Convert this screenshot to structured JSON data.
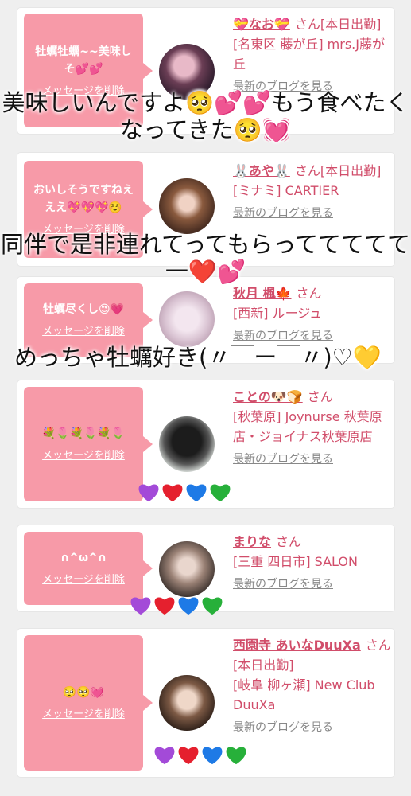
{
  "cards": [
    {
      "message": "牡蠣牡蠣~~美味しそ💕💕",
      "delete_label": "メッセージを削除",
      "name": "💝なお💝",
      "honorific": "さん[本日出勤]",
      "shop": "[名東区 藤が丘] mrs.J藤が丘",
      "blog_link": "最新のブログを見る"
    },
    {
      "message": "おいしそうですねえええ💖💖💖☺️",
      "delete_label": "メッセージを削除",
      "name": "🐰あや🐰",
      "honorific": "さん[本日出勤]",
      "shop": "[ミナミ] CARTIER",
      "blog_link": "最新のブログを見る"
    },
    {
      "message": "牡蠣尽くし😍💗",
      "delete_label": "メッセージを削除",
      "name": "秋月 楓🍁",
      "honorific": "さん",
      "shop": "[西新] ルージュ",
      "blog_link": "最新のブログを見る"
    },
    {
      "message": "💐🌷💐🌷💐🌷",
      "delete_label": "メッセージを削除",
      "name": "ことの🐶🍞",
      "honorific": "さん",
      "shop": "[秋葉原] Joynurse 秋葉原店・ジョイナス秋葉原店",
      "blog_link": "最新のブログを見る"
    },
    {
      "message": "∩^ω^∩",
      "delete_label": "メッセージを削除",
      "name": "まりな",
      "honorific": "さん",
      "shop": "[三重 四日市] SALON",
      "blog_link": "最新のブログを見る"
    },
    {
      "message": "🥺🥺💓",
      "delete_label": "メッセージを削除",
      "name": "西園寺 あいなDuuXa",
      "honorific": "さん[本日出勤]",
      "shop": "[岐阜 柳ヶ瀬] New Club DuuXa",
      "blog_link": "最新のブログを見る"
    }
  ],
  "overlay_captions": [
    "美味しいんですよ🥺💕💕もう食べたくなってきた🥺💓",
    "同伴で是非連れてってもらっててててて一❤️💕",
    "めっちゃ牡蠣好き(〃￣ー￣〃)♡💛"
  ],
  "colors": {
    "bubble": "#f79aa8",
    "name": "#d14d6a",
    "purple_heart": "#a34ad8",
    "red_heart": "#e5202e",
    "blue_heart": "#1e7ae6",
    "green_heart": "#27b03a"
  }
}
